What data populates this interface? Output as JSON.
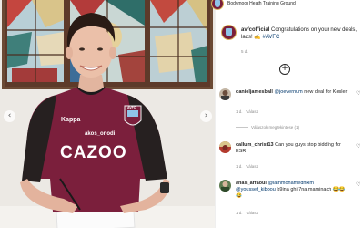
{
  "post": {
    "location": "Bodymoor Heath Training Ground",
    "caption": {
      "username": "avfcofficial",
      "text": " Congratulations on your new deals, lads! ✍️ ",
      "hashtag": "#AVFC",
      "time": "5 d."
    },
    "load_more_symbol": "+",
    "photo": {
      "sponsor_sleeve": "Kappa",
      "shirt_sponsor_small": "akos_onodi",
      "shirt_sponsor": "CAZOO",
      "badge": "AVFC"
    }
  },
  "comments": [
    {
      "username": "danieljamesball",
      "mention": "@joevernum",
      "text": " new deal for Kesler",
      "time": "1 d.",
      "reply": "Válasz",
      "view_replies": "Válaszok megtekintése (1)"
    },
    {
      "username": "callum_christ13",
      "mention": "",
      "text": " Can you guys stop bidding for ESR",
      "time": "1 d.",
      "reply": "Válasz"
    },
    {
      "username": "anas_arfaoui",
      "mention": "@iammohamedhkim",
      "text_after_first": " ",
      "mention2": "@youssef_kibbou",
      "text": " b9ina ghi 7na maminach 😂😂😂",
      "time": "1 d.",
      "reply": "Válasz"
    }
  ],
  "icons": {
    "heart": "♡",
    "arrow_left": "‹",
    "arrow_right": "›"
  },
  "colors": {
    "claret": "#7a1e3a",
    "sky_blue": "#8fc4e8",
    "link": "#00376b",
    "meta_gray": "#8e8e8e"
  }
}
